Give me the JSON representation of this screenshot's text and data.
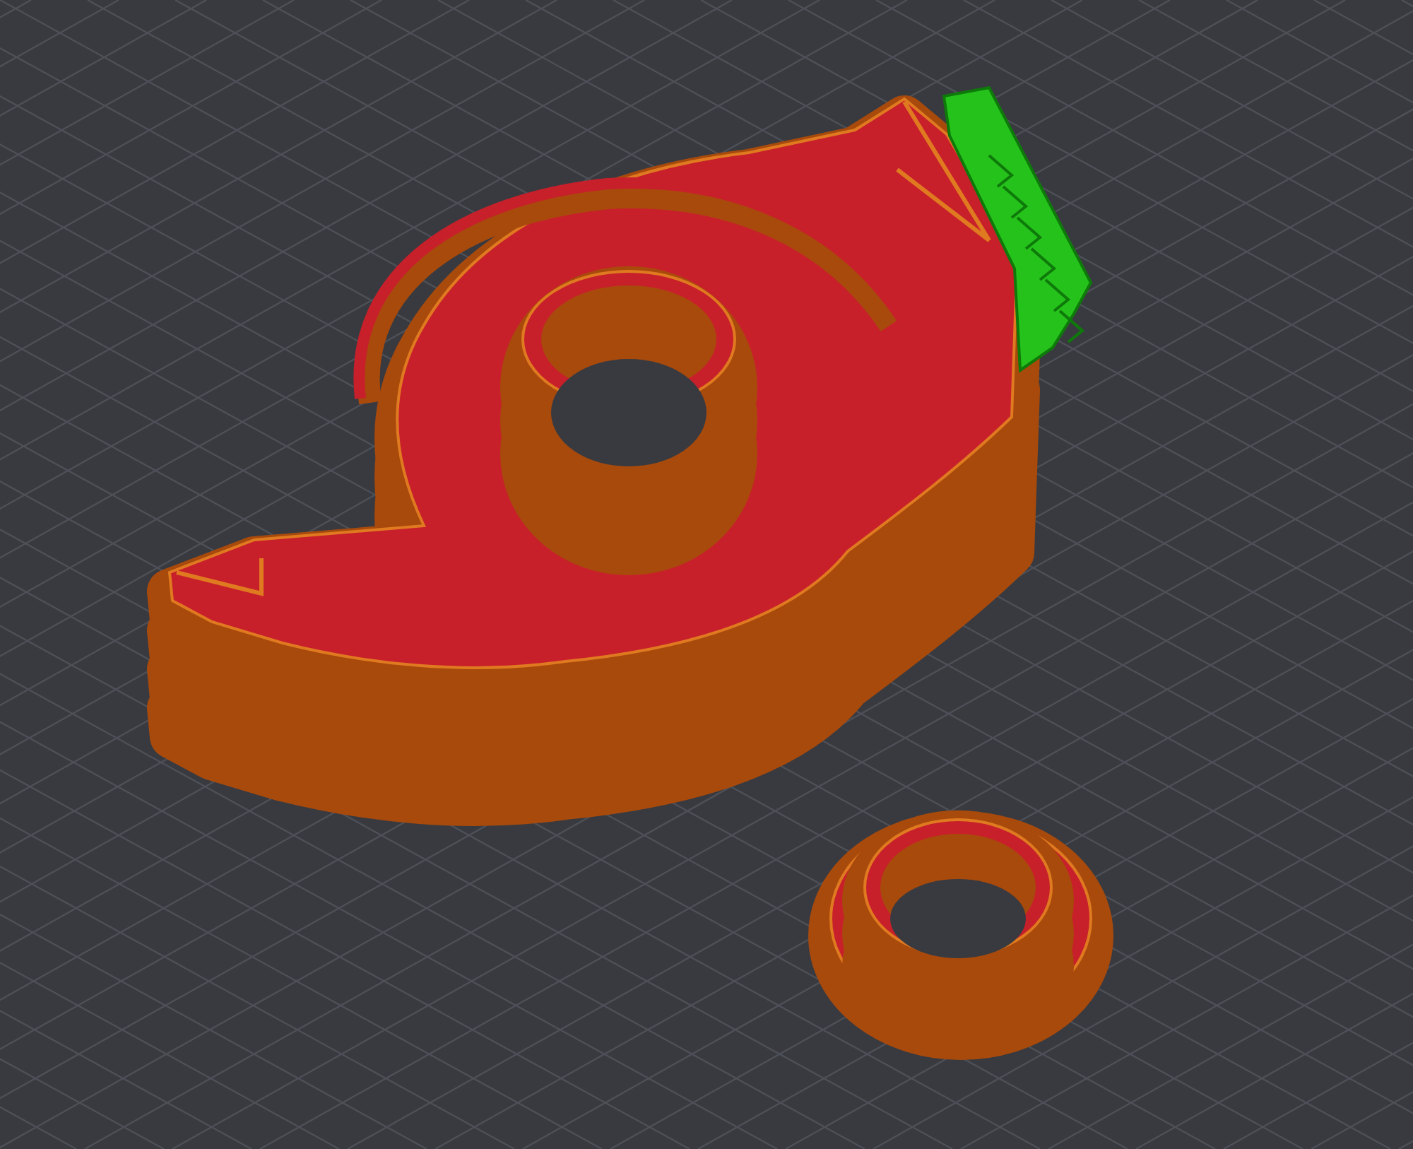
{
  "viewport": {
    "grid": true,
    "objects": [
      {
        "kind": "holder",
        "supports": true
      },
      {
        "kind": "bushing"
      }
    ]
  }
}
